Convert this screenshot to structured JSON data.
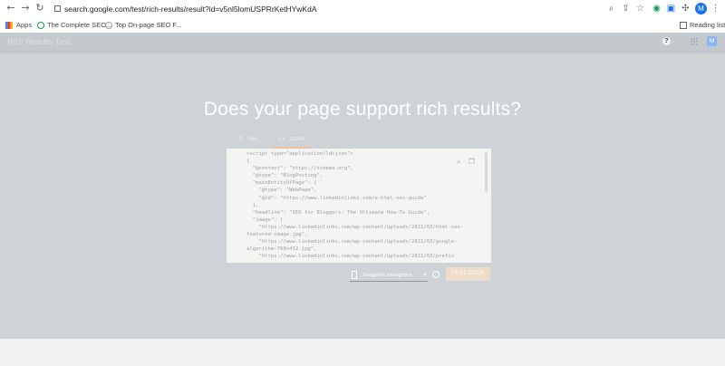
{
  "browser": {
    "url": "search.google.com/test/rich-results/result?id=v5nl5lomUSPRrKetHYwKdA",
    "bookmarks": [
      "Apps",
      "The Complete SEO...",
      "Top On-page SEO F..."
    ],
    "reading_list": "Reading list",
    "avatar_letter": "M"
  },
  "app": {
    "title": "Rich Results Test",
    "account_letter": "M"
  },
  "main": {
    "headline": "Does your page support rich results?",
    "tabs": [
      {
        "label": "URL",
        "selected": false
      },
      {
        "label": "CODE",
        "selected": true
      }
    ],
    "code_lines": [
      "<script type=\"application/ld+json\">",
      "{",
      "  \"@context\": \"https://schema.org\",",
      "  \"@type\": \"BlogPosting\",",
      "  \"mainEntityOfPage\": {",
      "    \"@type\": \"WebPage\",",
      "    \"@id\": \"https://www.linkedinlinks.com/e-html-seo-guide\"",
      "  },",
      "  \"headline\": \"SEO for Bloggers: The Ultimate How-To Guide\",",
      "  \"image\": [",
      "    \"https://www.linkedinlinks.com/wp-content/uploads/2021/03/html-seo-",
      "featured-image.jpg\",",
      "    \"https://www.linkedinlinks.com/wp-content/uploads/2021/03/google-",
      "algorithm-768x432.jpg\",",
      "    \"https://www.linkedinlinks.com/wp-content/uploads/2021/03/prefix"
    ],
    "device_select": "Googlebot smartphone",
    "test_button": "TEST CODE"
  },
  "colors": {
    "overlay": "#cdd3d6",
    "appbar": "#1e2a32",
    "test_button": "#ecdcc8"
  }
}
